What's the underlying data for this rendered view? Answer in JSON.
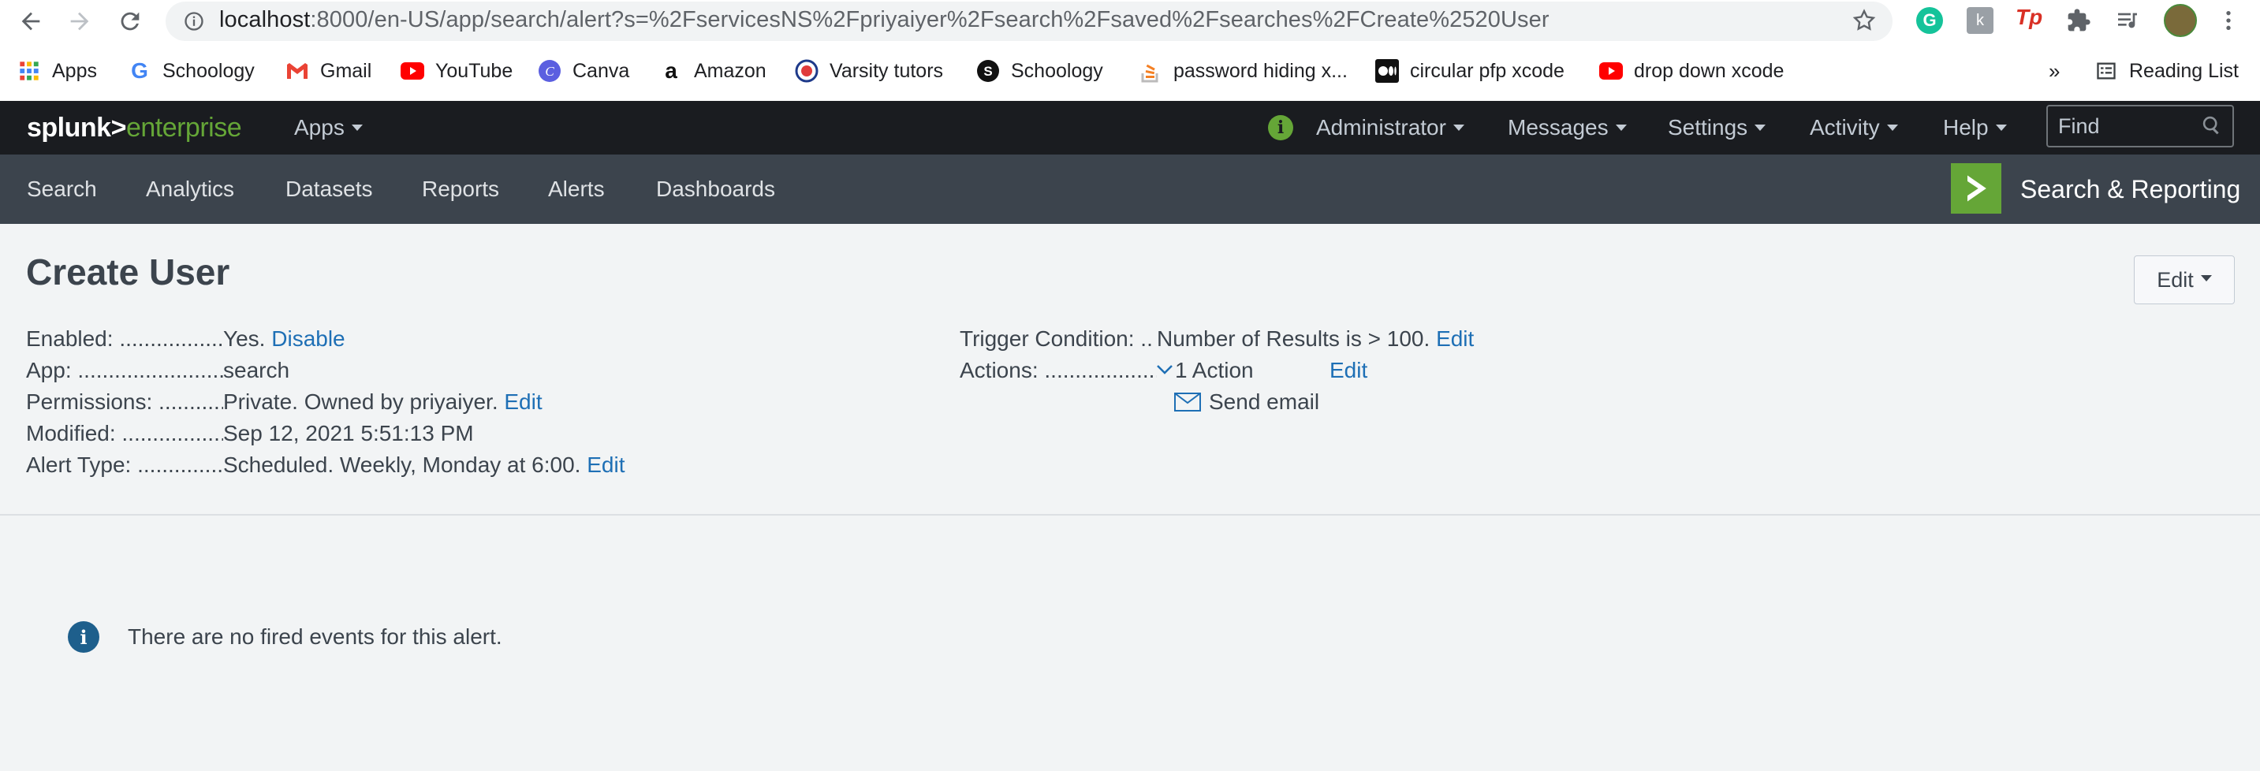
{
  "browser": {
    "url_host": "localhost",
    "url_rest": ":8000/en-US/app/search/alert?s=%2FservicesNS%2Fpriyaiyer%2Fsearch%2Fsaved%2Fsearches%2FCreate%2520User",
    "bookmarks": [
      {
        "label": "Apps",
        "icon": "apps-grid-icon"
      },
      {
        "label": "Schoology",
        "icon": "google-icon"
      },
      {
        "label": "Gmail",
        "icon": "gmail-icon"
      },
      {
        "label": "YouTube",
        "icon": "youtube-icon"
      },
      {
        "label": "Canva",
        "icon": "canva-icon"
      },
      {
        "label": "Amazon",
        "icon": "amazon-icon"
      },
      {
        "label": "Varsity tutors",
        "icon": "varsity-tutors-icon"
      },
      {
        "label": "Schoology",
        "icon": "schoology-icon"
      },
      {
        "label": "password hiding x...",
        "icon": "stackoverflow-icon"
      },
      {
        "label": "circular pfp xcode",
        "icon": "medium-icon"
      },
      {
        "label": "drop down xcode",
        "icon": "youtube-icon"
      }
    ],
    "overflow": "»",
    "reading_list": "Reading List"
  },
  "splunk": {
    "logo_a": "splunk>",
    "logo_b": "enterprise",
    "apps_menu": "Apps",
    "user_menu": "Administrator",
    "messages_menu": "Messages",
    "settings_menu": "Settings",
    "activity_menu": "Activity",
    "help_menu": "Help",
    "find_placeholder": "Find",
    "nav": [
      "Search",
      "Analytics",
      "Datasets",
      "Reports",
      "Alerts",
      "Dashboards"
    ],
    "app_name": "Search & Reporting"
  },
  "alert": {
    "title": "Create User",
    "edit_button": "Edit",
    "enabled_label": "Enabled: ....................",
    "enabled_value": "Yes.",
    "enabled_link": "Disable",
    "app_label": "App: ............................",
    "app_value": "search",
    "permissions_label": "Permissions: ............",
    "permissions_value": "Private. Owned by priyaiyer.",
    "permissions_link": "Edit",
    "modified_label": "Modified: ...................",
    "modified_value": "Sep 12, 2021 5:51:13 PM",
    "alert_type_label": "Alert Type: ................",
    "alert_type_value": "Scheduled. Weekly, Monday at 6:00.",
    "alert_type_link": "Edit",
    "trigger_label": "Trigger Condition: ..",
    "trigger_value": "Number of Results is > 100.",
    "trigger_link": "Edit",
    "actions_label": "Actions: .....................",
    "actions_value": "1 Action",
    "actions_link": "Edit",
    "action_item": "Send email",
    "no_events": "There are no fired events for this alert."
  },
  "colors": {
    "accent_link": "#1e6fb5",
    "splunk_green": "#65a637",
    "appbar_bg": "#1a1c20",
    "navbar_bg": "#3c444d"
  }
}
